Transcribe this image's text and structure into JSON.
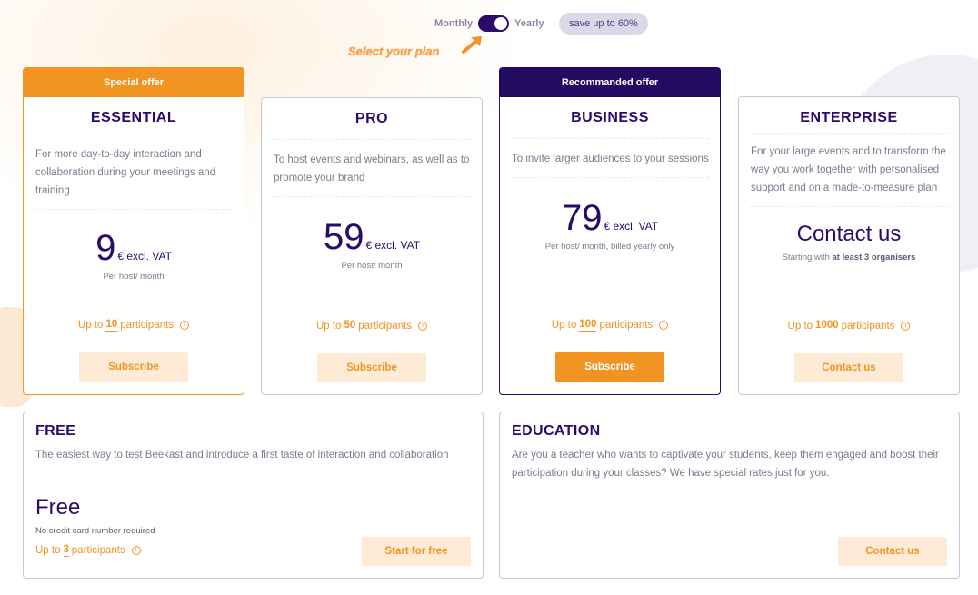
{
  "billing": {
    "monthly_label": "Monthly",
    "yearly_label": "Yearly",
    "selected": "Yearly",
    "save_badge": "save up to 60%",
    "hint": "Select your plan"
  },
  "colors": {
    "brand_purple": "#2a0a6b",
    "accent_orange": "#f29422",
    "button_light": "#fdebd5"
  },
  "plans": [
    {
      "ribbon": "Special offer",
      "name": "ESSENTIAL",
      "description": "For more day-to-day interaction and collaboration during your meetings and training",
      "price": "9",
      "price_unit": "€ excl. VAT",
      "per": "Per host/ month",
      "participants_prefix": "Up to",
      "participants_count": "10",
      "participants_suffix": "participants",
      "button": "Subscribe"
    },
    {
      "name": "PRO",
      "description": "To host events and webinars, as well as to promote your brand",
      "price": "59",
      "price_unit": "€ excl. VAT",
      "per": "Per host/ month",
      "participants_prefix": "Up to",
      "participants_count": "50",
      "participants_suffix": "participants",
      "button": "Subscribe"
    },
    {
      "ribbon": "Recommanded offer",
      "name": "BUSINESS",
      "description": "To invite larger audiences to your sessions",
      "price": "79",
      "price_unit": "€ excl. VAT",
      "per": "Per host/ month, billed yearly only",
      "participants_prefix": "Up to",
      "participants_count": "100",
      "participants_suffix": "participants",
      "button": "Subscribe"
    },
    {
      "name": "ENTERPRISE",
      "description": "For your large events and to transform the way you work together with personalised support and on a made-to-measure plan",
      "price_text": "Contact us",
      "starting_prefix": "Starting with",
      "starting_bold": "at least 3 organisers",
      "participants_prefix": "Up to",
      "participants_count": "1000",
      "participants_suffix": "participants",
      "button": "Contact us"
    }
  ],
  "free": {
    "title": "FREE",
    "description": "The easiest way to test Beekast and introduce a first taste of interaction and collaboration",
    "price_text": "Free",
    "note": "No credit card number required",
    "participants_prefix": "Up to",
    "participants_count": "3",
    "participants_suffix": "participants",
    "button": "Start for free"
  },
  "education": {
    "title": "EDUCATION",
    "description": "Are you a teacher who wants to captivate your students, keep them engaged and boost their participation during your classes? We have special rates just for you.",
    "button": "Contact us"
  }
}
